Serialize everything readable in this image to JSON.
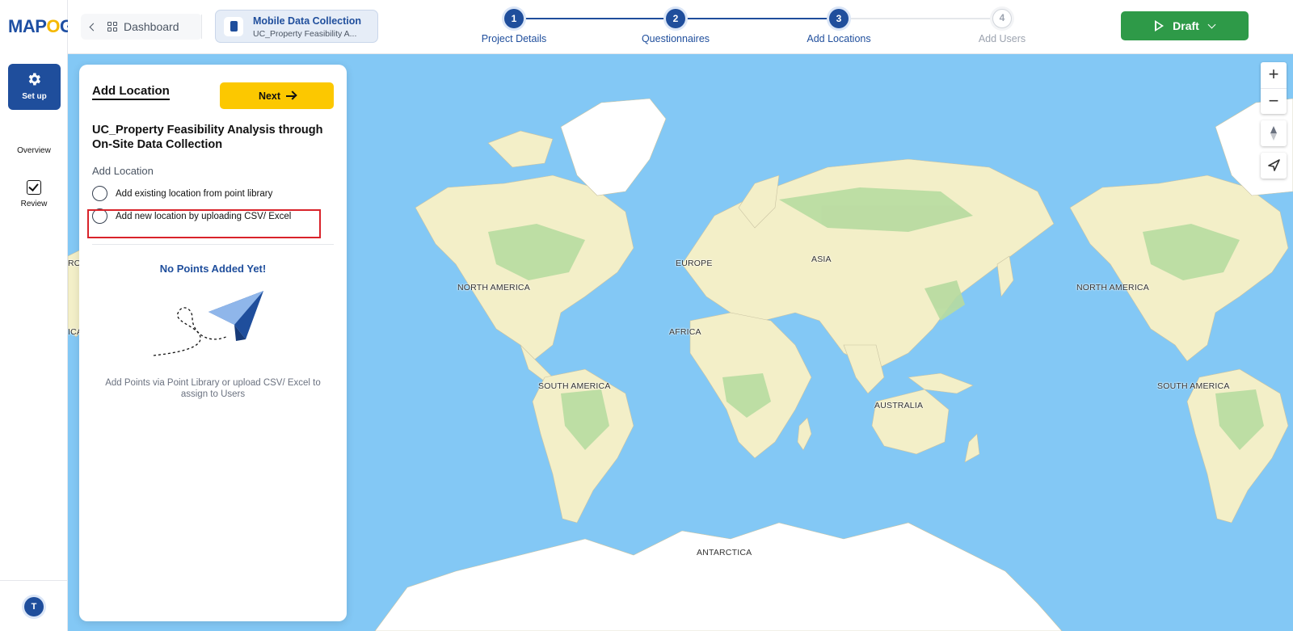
{
  "app": {
    "logo_text_left": "MAP",
    "logo_text_right": "G",
    "logo_o": "O"
  },
  "rail": {
    "setup_label": "Set up",
    "overview_label": "Overview",
    "review_label": "Review",
    "avatar_initial": "T"
  },
  "topbar": {
    "dashboard_label": "Dashboard",
    "project_type": "Mobile Data Collection",
    "project_name_short": "UC_Property Feasibility A...",
    "draft_label": "Draft"
  },
  "stepper": {
    "steps": [
      {
        "number": "1",
        "label": "Project Details",
        "state": "done"
      },
      {
        "number": "2",
        "label": "Questionnaires",
        "state": "done"
      },
      {
        "number": "3",
        "label": "Add Locations",
        "state": "done"
      },
      {
        "number": "4",
        "label": "Add Users",
        "state": "todo"
      }
    ]
  },
  "panel": {
    "title": "Add Location",
    "next_label": "Next",
    "project_title": "UC_Property Feasibility Analysis through On-Site Data Collection",
    "section_label": "Add Location",
    "options": [
      {
        "label": "Add existing location from point library",
        "selected": false
      },
      {
        "label": "Add new location by uploading CSV/ Excel",
        "selected": false
      }
    ],
    "empty_title": "No Points Added Yet!",
    "empty_desc": "Add Points via Point Library or upload CSV/ Excel to assign to Users"
  },
  "map": {
    "labels": {
      "north_america": "NORTH AMERICA",
      "north_america_2": "NORTH AMERICA",
      "south_america": "SOUTH AMERICA",
      "south_america_2": "SOUTH AMERICA",
      "europe": "EUROPE",
      "asia": "ASIA",
      "africa": "AFRICA",
      "australia": "AUSTRALIA",
      "antarctica": "ANTARCTICA",
      "edge_left_1": "RO",
      "edge_left_2": "ICA"
    },
    "zoom_in": "+",
    "zoom_out": "−",
    "colors": {
      "ocean": "#83c8f5",
      "land": "#f3efc8",
      "forest": "#b7dba0",
      "ice": "#ffffff"
    }
  }
}
